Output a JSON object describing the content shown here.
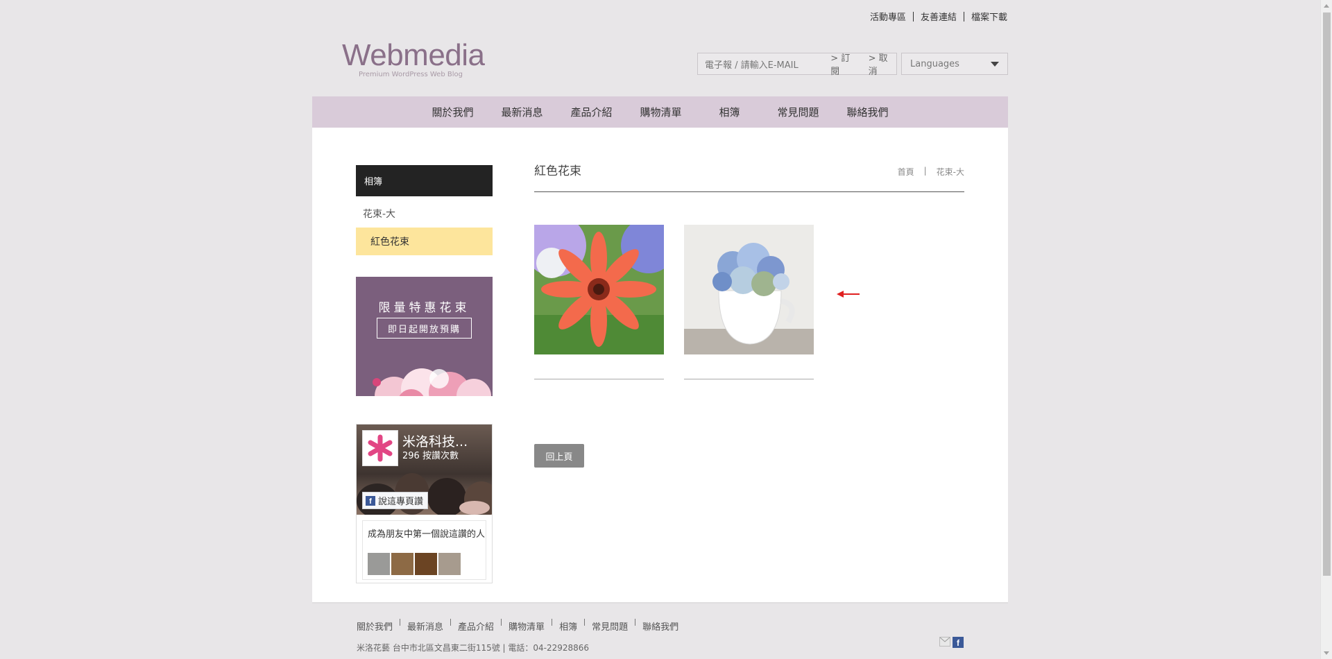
{
  "top_links": [
    "活動專區",
    "友善連結",
    "檔案下載"
  ],
  "logo": {
    "title": "Webmedia",
    "subtitle": "Premium WordPress Web Blog"
  },
  "newsletter": {
    "placeholder": "電子報 / 請輸入E-MAIL",
    "subscribe": "> 訂閱",
    "cancel": "> 取消"
  },
  "languages": {
    "selected": "Languages"
  },
  "nav": [
    "關於我們",
    "最新消息",
    "產品介紹",
    "購物清單",
    "相簿",
    "常見問題",
    "聯絡我們"
  ],
  "sidebar": {
    "heading": "相簿",
    "items": [
      {
        "label": "花束-大",
        "active": false
      },
      {
        "label": "紅色花束",
        "active": true
      }
    ],
    "banner": {
      "headline": "限量特惠花束",
      "cta": "即日起開放預購"
    },
    "facebook": {
      "page_name": "米洛科技...",
      "likes": "296 按讚次數",
      "like_button": "說這專頁讚",
      "friends_text": "成為朋友中第一個說這讚的人"
    }
  },
  "main": {
    "title": "紅色花束",
    "breadcrumb": [
      "首頁",
      "|",
      "花束-大"
    ],
    "back_button": "回上頁"
  },
  "footer": {
    "nav": [
      "關於我們",
      "最新消息",
      "產品介紹",
      "購物清單",
      "相簿",
      "常見問題",
      "聯絡我們"
    ],
    "address": "米洛花藝  台中市北區文昌東二街115號 | 電話：04-22928866"
  },
  "colors": {
    "nav_bg": "#d9cbd9",
    "sidebar_head": "#232323",
    "active_item": "#fde59c",
    "banner_bg": "#7b5f7d",
    "logo": "#8a7089",
    "arrow": "#e02020"
  }
}
